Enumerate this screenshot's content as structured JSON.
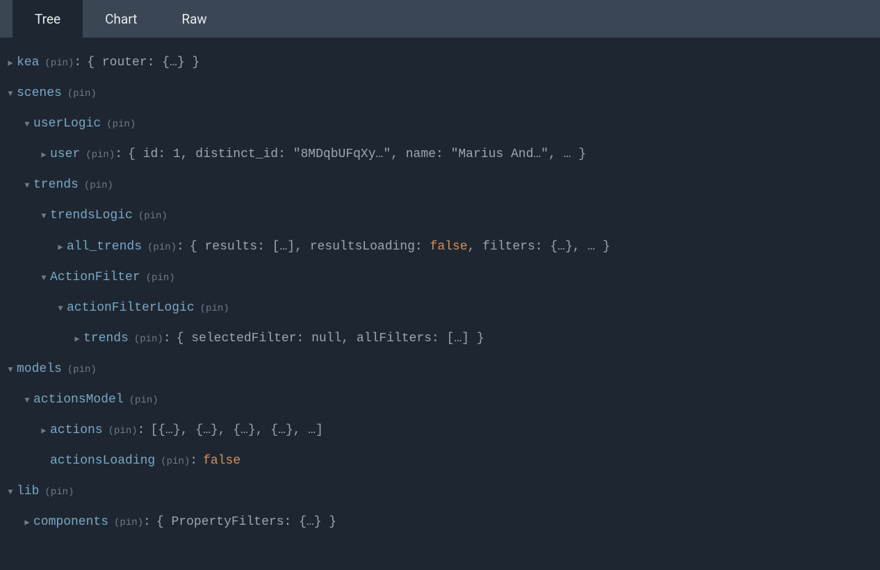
{
  "tabs": {
    "tree": "Tree",
    "chart": "Chart",
    "raw": "Raw",
    "active": "tree"
  },
  "pin_label": "(pin)",
  "arrows": {
    "collapsed": "▶",
    "expanded": "▼"
  },
  "rows": [
    {
      "indent": 0,
      "expanded": false,
      "key": "kea",
      "pin": true,
      "colon": true,
      "value_html": "{ router: {…} }"
    },
    {
      "indent": 0,
      "expanded": true,
      "key": "scenes",
      "pin": true,
      "colon": false
    },
    {
      "indent": 1,
      "expanded": true,
      "key": "userLogic",
      "pin": true,
      "colon": false
    },
    {
      "indent": 2,
      "expanded": false,
      "key": "user",
      "pin": true,
      "colon": true,
      "value_html": "{ id: <span class=\"num\">1</span>, distinct_id: <span class=\"string\">\"8MDqbUFqXy…\"</span>, name: <span class=\"string\">\"Marius And…\"</span>, … }"
    },
    {
      "indent": 1,
      "expanded": true,
      "key": "trends",
      "pin": true,
      "colon": false
    },
    {
      "indent": 2,
      "expanded": true,
      "key": "trendsLogic",
      "pin": true,
      "colon": false
    },
    {
      "indent": 3,
      "expanded": false,
      "key": "all_trends",
      "pin": true,
      "colon": true,
      "value_html": "{ results: […], resultsLoading: <span class=\"bool\">false</span>, filters: {…}, … }"
    },
    {
      "indent": 2,
      "expanded": true,
      "key": "ActionFilter",
      "pin": true,
      "colon": false
    },
    {
      "indent": 3,
      "expanded": true,
      "key": "actionFilterLogic",
      "pin": true,
      "colon": false
    },
    {
      "indent": 4,
      "expanded": false,
      "key": "trends",
      "pin": true,
      "colon": true,
      "value_html": "{ selectedFilter: <span class=\"null\">null</span>, allFilters: […] }"
    },
    {
      "indent": 0,
      "expanded": true,
      "key": "models",
      "pin": true,
      "colon": false
    },
    {
      "indent": 1,
      "expanded": true,
      "key": "actionsModel",
      "pin": true,
      "colon": false
    },
    {
      "indent": 2,
      "expanded": false,
      "key": "actions",
      "pin": true,
      "colon": true,
      "value_html": "[{…}, {…}, {…}, {…}, …]"
    },
    {
      "indent": 2,
      "no_arrow": true,
      "key": "actionsLoading",
      "pin": true,
      "colon": true,
      "value_html": "<span class=\"bool\">false</span>"
    },
    {
      "indent": 0,
      "expanded": true,
      "key": "lib",
      "pin": true,
      "colon": false
    },
    {
      "indent": 1,
      "expanded": false,
      "key": "components",
      "pin": true,
      "colon": true,
      "value_html": "{ PropertyFilters: {…} }"
    }
  ]
}
